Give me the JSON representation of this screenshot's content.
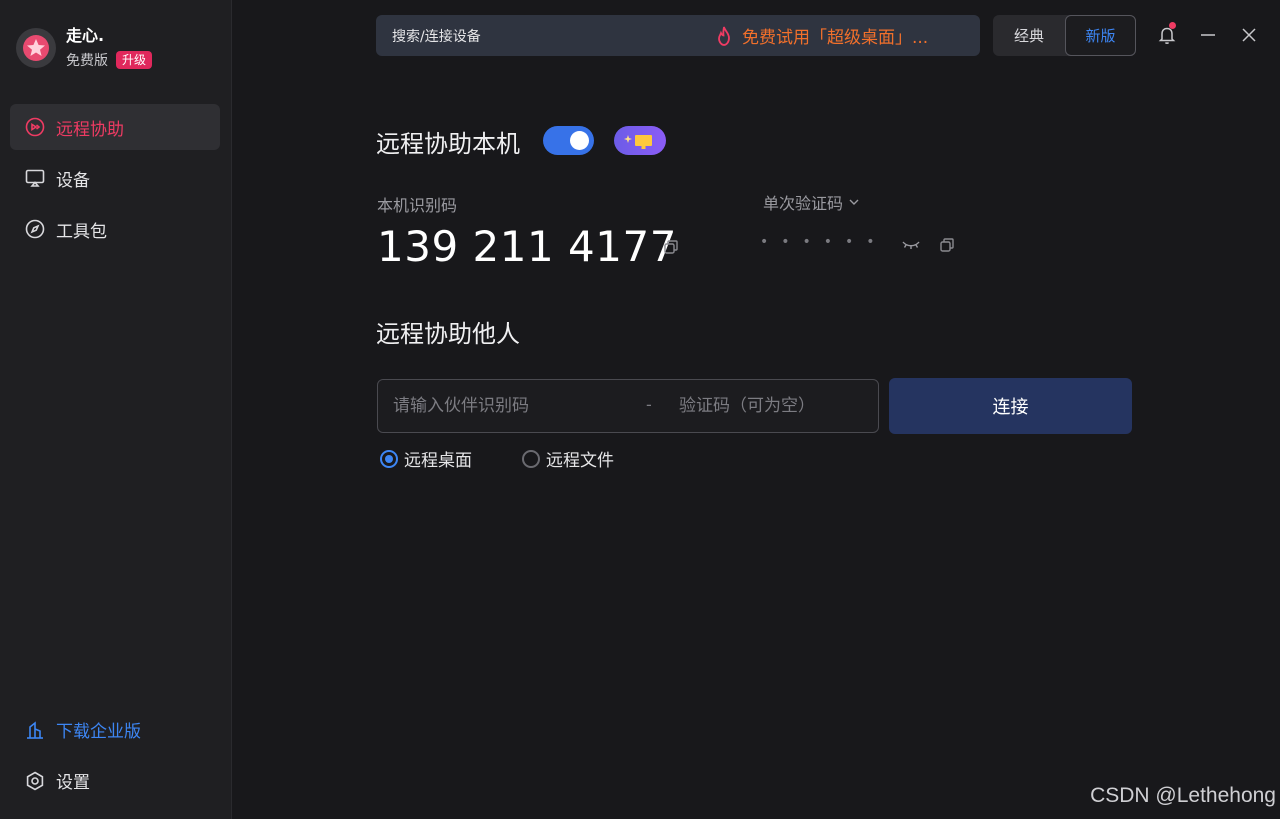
{
  "profile": {
    "username": "走心.",
    "plan": "免费版",
    "upgrade_label": "升级"
  },
  "sidebar": {
    "items": [
      {
        "label": "远程协助",
        "icon": "remote-assist-icon",
        "active": true
      },
      {
        "label": "设备",
        "icon": "monitor-icon",
        "active": false
      },
      {
        "label": "工具包",
        "icon": "compass-icon",
        "active": false
      }
    ],
    "download_label": "下载企业版",
    "settings_label": "设置"
  },
  "topbar": {
    "search_label": "搜索/连接设备",
    "promo_text": "免费试用「超级桌面」...",
    "mode_classic": "经典",
    "mode_new": "新版"
  },
  "local": {
    "title": "远程协助本机",
    "toggle_on": true,
    "id_label": "本机识别码",
    "device_id": "139 211 4177",
    "code_label": "单次验证码",
    "code_masked": "••••••"
  },
  "remote": {
    "title": "远程协助他人",
    "partner_placeholder": "请输入伙伴识别码",
    "separator": "-",
    "code_placeholder": "验证码（可为空）",
    "connect_label": "连接",
    "options": [
      {
        "label": "远程桌面",
        "checked": true
      },
      {
        "label": "远程文件",
        "checked": false
      }
    ]
  },
  "colors": {
    "accent_red": "#ef3b63",
    "accent_blue": "#3d86f4",
    "promo_orange": "#f2702b"
  },
  "watermark": "CSDN @Lethehong"
}
